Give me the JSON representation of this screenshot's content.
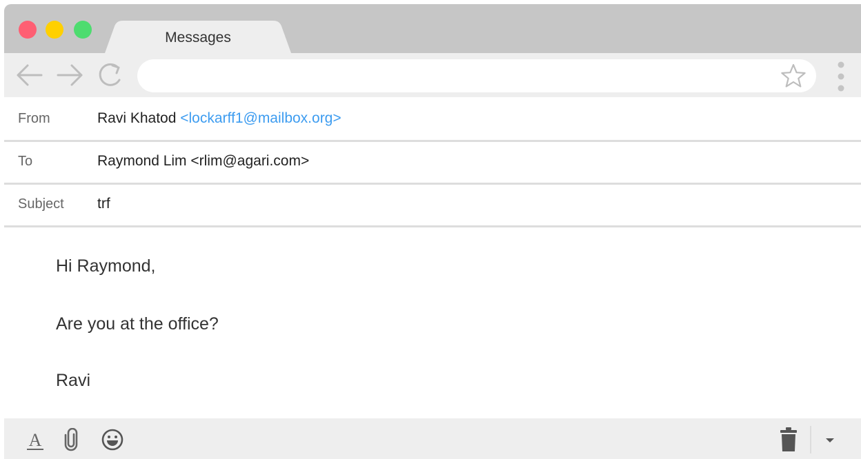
{
  "window": {
    "tab_title": "Messages"
  },
  "toolbar": {
    "back_icon": "arrow-left-icon",
    "forward_icon": "arrow-right-icon",
    "reload_icon": "reload-icon",
    "address_value": "",
    "bookmark_icon": "star-icon",
    "menu_icon": "kebab-menu-icon"
  },
  "header": {
    "from": {
      "label": "From",
      "name": "Ravi Khatod",
      "email": "<lockarff1@mailbox.org>"
    },
    "to": {
      "label": "To",
      "value": "Raymond Lim <rlim@agari.com>"
    },
    "subject": {
      "label": "Subject",
      "value": "trf"
    }
  },
  "body": {
    "greeting": "Hi Raymond,",
    "question": "Are you at the office?",
    "signature": "Ravi"
  },
  "bottom_toolbar": {
    "format_icon": "text-format-icon",
    "attach_icon": "paperclip-icon",
    "emoji_icon": "smiley-icon",
    "trash_icon": "trash-icon",
    "dropdown_icon": "chevron-down-icon"
  },
  "colors": {
    "close": "#fe5f73",
    "minimize": "#ffd000",
    "maximize": "#4ddc6f",
    "link": "#3d9cf0",
    "chrome": "#c6c6c6",
    "toolbar": "#eeeeee"
  }
}
